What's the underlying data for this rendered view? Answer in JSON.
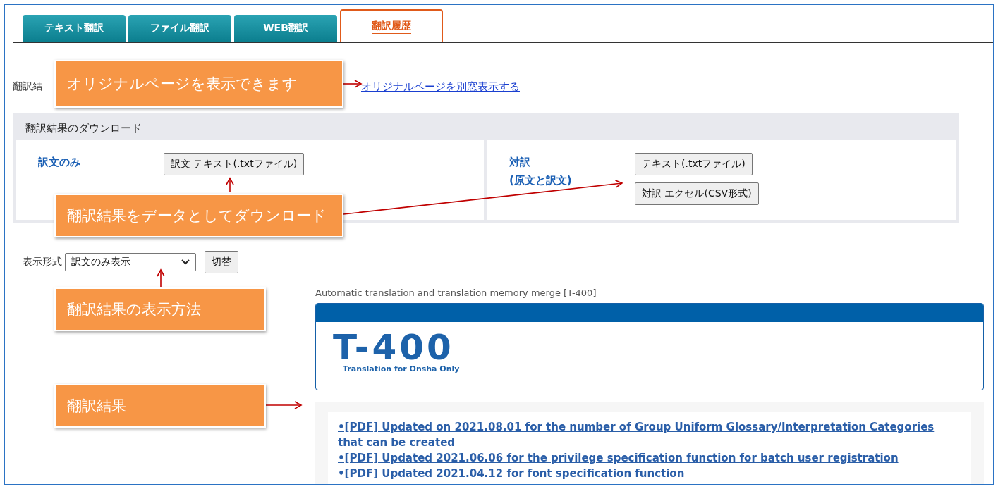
{
  "tabs": [
    {
      "label": "テキスト翻訳",
      "selected": false
    },
    {
      "label": "ファイル翻訳",
      "selected": false
    },
    {
      "label": "WEB翻訳",
      "selected": false
    },
    {
      "label": "翻訳履歴",
      "selected": true
    }
  ],
  "original_page": {
    "label": "翻訳結",
    "link": "オリジナルページを別窓表示する"
  },
  "download": {
    "title": "翻訳結果のダウンロード",
    "groups": [
      {
        "label": [
          "訳文のみ"
        ],
        "buttons": [
          "訳文 テキスト(.txtファイル)"
        ]
      },
      {
        "label": [
          "対訳",
          "(原文と訳文)"
        ],
        "buttons": [
          "テキスト(.txtファイル)",
          "対訳 エクセル(CSV形式)"
        ]
      }
    ]
  },
  "display_format": {
    "label": "表示形式",
    "value": "訳文のみ表示",
    "button": "切替"
  },
  "result": {
    "caption": "Automatic translation and translation memory merge [T-400]",
    "logo": {
      "mark": "T-400",
      "tagline": "Translation for Onsha Only"
    },
    "links": [
      "•[PDF] Updated on 2021.08.01 for the number of Group Uniform Glossary/Interpretation Categories that can be created",
      "•[PDF] Updated 2021.06.06 for the privilege specification function for batch user registration",
      "•[PDF] Updated 2021.04.12 for font specification function"
    ]
  },
  "callouts": [
    {
      "text": "オリジナルページを表示できます"
    },
    {
      "text": "翻訳結果をデータとしてダウンロード"
    },
    {
      "text": "翻訳結果の表示方法"
    },
    {
      "text": "翻訳結果"
    }
  ]
}
